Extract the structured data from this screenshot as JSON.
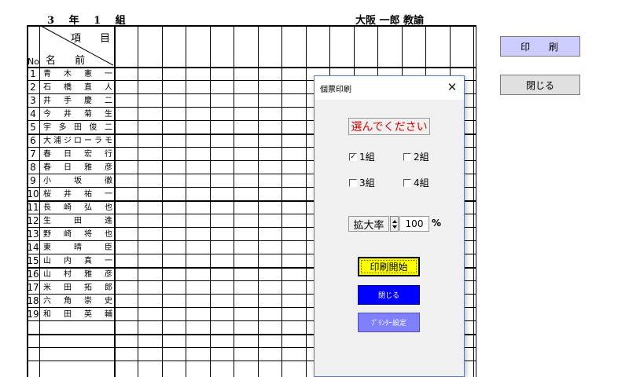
{
  "header": {
    "class_label": "3 年 1 組",
    "teacher_label": "大阪 一郎 教諭"
  },
  "table": {
    "header_item": "項 目",
    "header_name": "名 前",
    "header_no": "No",
    "students": [
      {
        "no": "1",
        "name": "青木憲一"
      },
      {
        "no": "2",
        "name": "石橋直人"
      },
      {
        "no": "3",
        "name": "井手慶二"
      },
      {
        "no": "4",
        "name": "今井菊生"
      },
      {
        "no": "5",
        "name": "宇多田俊二"
      },
      {
        "no": "6",
        "name": "大浦ジローラモ"
      },
      {
        "no": "7",
        "name": "春日宏行"
      },
      {
        "no": "8",
        "name": "春日雅彦"
      },
      {
        "no": "9",
        "name": "小坂徹"
      },
      {
        "no": "10",
        "name": "桜井祐一"
      },
      {
        "no": "11",
        "name": "長崎弘也"
      },
      {
        "no": "12",
        "name": "生田進"
      },
      {
        "no": "13",
        "name": "野崎将也"
      },
      {
        "no": "14",
        "name": "東晴臣"
      },
      {
        "no": "15",
        "name": "山内真一"
      },
      {
        "no": "16",
        "name": "山村雅彦"
      },
      {
        "no": "17",
        "name": "米田拓郎"
      },
      {
        "no": "18",
        "name": "六角崇史"
      },
      {
        "no": "19",
        "name": "和田英輔"
      }
    ]
  },
  "side_buttons": {
    "print_label": "印 刷",
    "close_label": "閉じる"
  },
  "dialog": {
    "title": "個票印刷",
    "close_glyph": "✕",
    "prompt": "選んでください",
    "checkboxes": [
      {
        "label": "1組",
        "checked": true
      },
      {
        "label": "2組",
        "checked": false
      },
      {
        "label": "3組",
        "checked": false
      },
      {
        "label": "4組",
        "checked": false
      }
    ],
    "zoom_label": "拡大率",
    "zoom_value": "100",
    "zoom_unit": "%",
    "start_label": "印刷開始",
    "close_label": "閉じる",
    "printer_label": "ﾌﾟﾘﾝﾀｰ設定"
  },
  "colors": {
    "print_button": "#ccccff",
    "start_button": "#ffff00",
    "close_button": "#0000ff",
    "printer_button": "#8080ff",
    "prompt_text": "#e00000"
  }
}
